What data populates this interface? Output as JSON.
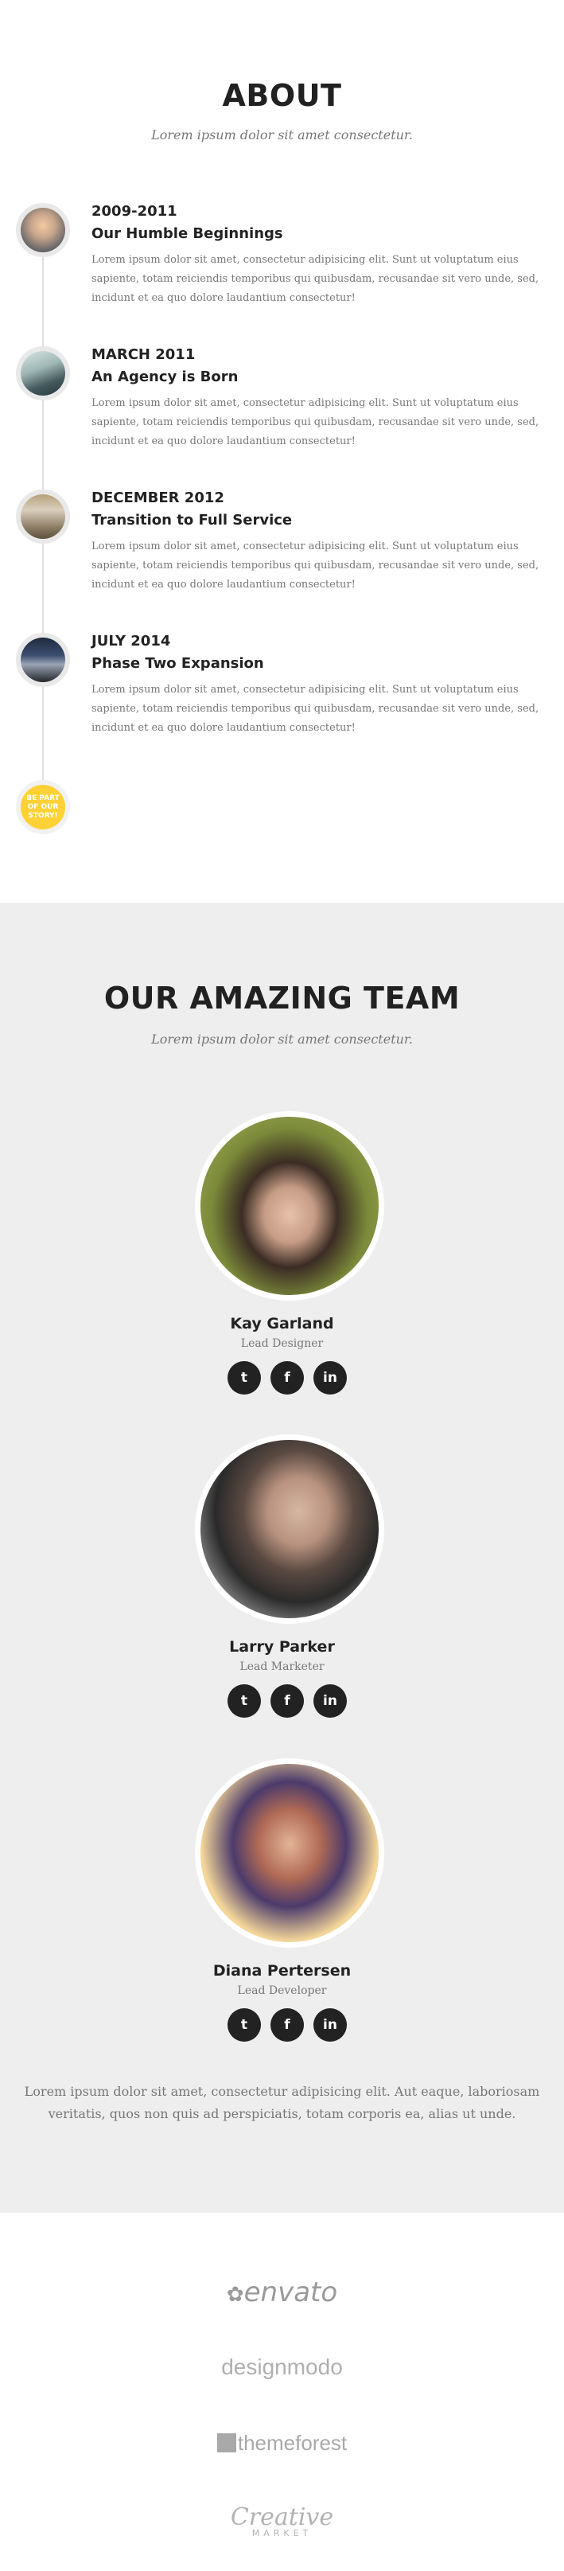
{
  "about": {
    "title": "ABOUT",
    "subtitle": "Lorem ipsum dolor sit amet consectetur.",
    "timeline": [
      {
        "date": "2009-2011",
        "heading": "Our Humble Beginnings",
        "body": "Lorem ipsum dolor sit amet, consectetur adipisicing elit. Sunt ut voluptatum eius sapiente, totam reiciendis temporibus qui quibusdam, recusandae sit vero unde, sed, incidunt et ea quo dolore laudantium consectetur!"
      },
      {
        "date": "MARCH 2011",
        "heading": "An Agency is Born",
        "body": "Lorem ipsum dolor sit amet, consectetur adipisicing elit. Sunt ut voluptatum eius sapiente, totam reiciendis temporibus qui quibusdam, recusandae sit vero unde, sed, incidunt et ea quo dolore laudantium consectetur!"
      },
      {
        "date": "DECEMBER 2012",
        "heading": "Transition to Full Service",
        "body": "Lorem ipsum dolor sit amet, consectetur adipisicing elit. Sunt ut voluptatum eius sapiente, totam reiciendis temporibus qui quibusdam, recusandae sit vero unde, sed, incidunt et ea quo dolore laudantium consectetur!"
      },
      {
        "date": "JULY 2014",
        "heading": "Phase Two Expansion",
        "body": "Lorem ipsum dolor sit amet, consectetur adipisicing elit. Sunt ut voluptatum eius sapiente, totam reiciendis temporibus qui quibusdam, recusandae sit vero unde, sed, incidunt et ea quo dolore laudantium consectetur!"
      }
    ],
    "story": [
      "BE PART",
      "OF OUR",
      "STORY!"
    ],
    "accent": "#fed136"
  },
  "team": {
    "title": "OUR AMAZING TEAM",
    "subtitle": "Lorem ipsum dolor sit amet consectetur.",
    "members": [
      {
        "name": "Kay Garland",
        "role": "Lead Designer"
      },
      {
        "name": "Larry Parker",
        "role": "Lead Marketer"
      },
      {
        "name": "Diana Pertersen",
        "role": "Lead Developer"
      }
    ],
    "social_icons": [
      "twitter-icon",
      "facebook-icon",
      "linkedin-icon"
    ],
    "text": "Lorem ipsum dolor sit amet, consectetur adipisicing elit. Aut eaque, laboriosam veritatis, quos non quis ad perspiciatis, totam corporis ea, alias ut unde."
  },
  "clients": {
    "logos": [
      "envato",
      "designmodo",
      "themeforest",
      "Creative",
      "MARKET"
    ]
  }
}
